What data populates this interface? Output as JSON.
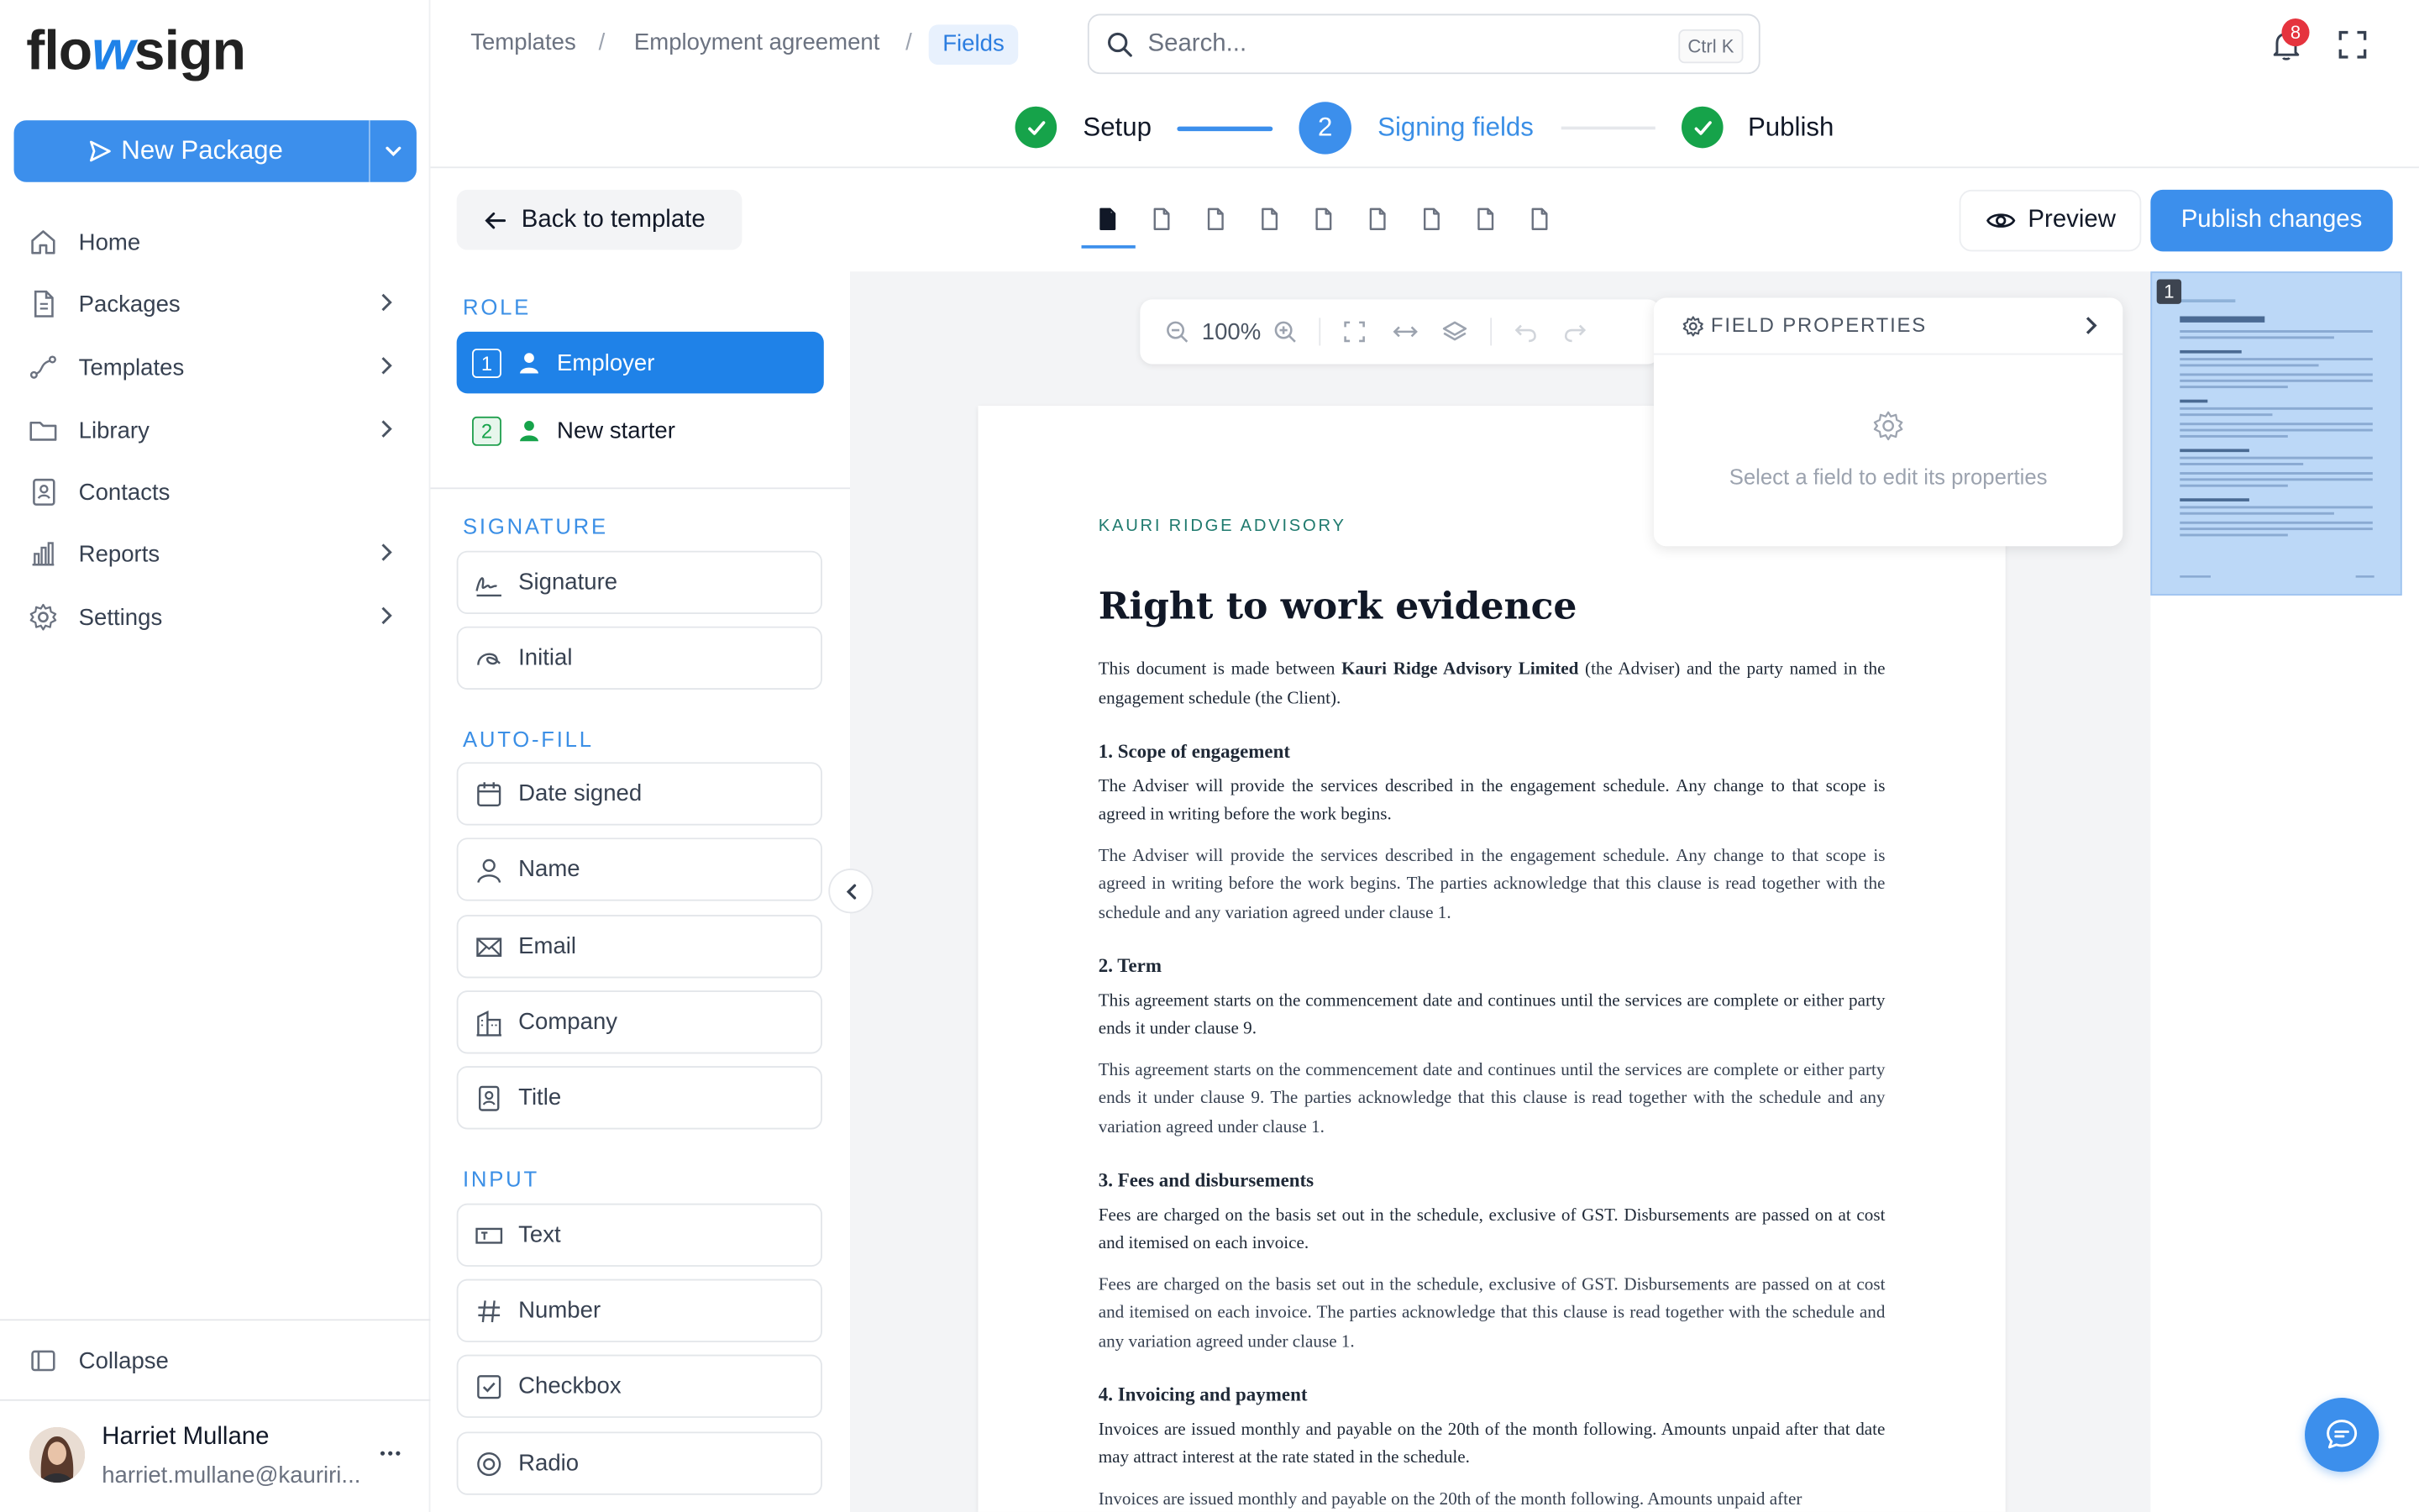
{
  "app": {
    "logo_pre": "flo",
    "logo_mid": "w",
    "logo_post": "sign"
  },
  "sidebar": {
    "new_package": "New Package",
    "items": [
      {
        "label": "Home"
      },
      {
        "label": "Packages"
      },
      {
        "label": "Templates"
      },
      {
        "label": "Library"
      },
      {
        "label": "Contacts"
      },
      {
        "label": "Reports"
      },
      {
        "label": "Settings"
      }
    ],
    "collapse": "Collapse",
    "user": {
      "name": "Harriet Mullane",
      "email": "harriet.mullane@kauriri..."
    }
  },
  "breadcrumb": {
    "items": [
      "Templates",
      "Employment agreement"
    ],
    "active": "Fields"
  },
  "search": {
    "placeholder": "Search...",
    "shortcut": "Ctrl K"
  },
  "notifications": {
    "count": "8"
  },
  "stepper": {
    "steps": [
      {
        "label": "Setup",
        "state": "done"
      },
      {
        "label": "Signing fields",
        "state": "current",
        "number": "2"
      },
      {
        "label": "Publish",
        "state": "done"
      }
    ]
  },
  "panel": {
    "back": "Back to template",
    "role_title": "ROLE",
    "roles": [
      {
        "num": "1",
        "label": "Employer"
      },
      {
        "num": "2",
        "label": "New starter"
      }
    ],
    "signature_title": "SIGNATURE",
    "signature_fields": [
      "Signature",
      "Initial"
    ],
    "autofill_title": "AUTO-FILL",
    "autofill_fields": [
      "Date signed",
      "Name",
      "Email",
      "Company",
      "Title"
    ],
    "input_title": "INPUT",
    "input_fields": [
      "Text",
      "Number",
      "Checkbox",
      "Radio"
    ]
  },
  "toolbar": {
    "zoom": "100%",
    "preview": "Preview",
    "publish": "Publish changes"
  },
  "field_properties": {
    "title": "FIELD PROPERTIES",
    "hint": "Select a field to edit its properties"
  },
  "document": {
    "company": "KAURI RIDGE ADVISORY",
    "title": "Right to work evidence",
    "intro_pre": "This document is made between ",
    "intro_bold": "Kauri Ridge Advisory Limited",
    "intro_post": " (the Adviser) and the party named in the engagement schedule (the Client).",
    "sections": [
      {
        "heading": "1. Scope of engagement",
        "p1": "The Adviser will provide the services described in the engagement schedule. Any change to that scope is agreed in writing before the work begins.",
        "p2": "The Adviser will provide the services described in the engagement schedule. Any change to that scope is agreed in writing before the work begins. The parties acknowledge that this clause is read together with the schedule and any variation agreed under clause 1."
      },
      {
        "heading": "2. Term",
        "p1": "This agreement starts on the commencement date and continues until the services are complete or either party ends it under clause 9.",
        "p2": "This agreement starts on the commencement date and continues until the services are complete or either party ends it under clause 9. The parties acknowledge that this clause is read together with the schedule and any variation agreed under clause 1."
      },
      {
        "heading": "3. Fees and disbursements",
        "p1": "Fees are charged on the basis set out in the schedule, exclusive of GST. Disbursements are passed on at cost and itemised on each invoice.",
        "p2": "Fees are charged on the basis set out in the schedule, exclusive of GST. Disbursements are passed on at cost and itemised on each invoice. The parties acknowledge that this clause is read together with the schedule and any variation agreed under clause 1."
      },
      {
        "heading": "4. Invoicing and payment",
        "p1": "Invoices are issued monthly and payable on the 20th of the month following. Amounts unpaid after that date may attract interest at the rate stated in the schedule.",
        "p2": "Invoices are issued monthly and payable on the 20th of the month following. Amounts unpaid after"
      }
    ]
  },
  "thumbnail": {
    "page": "1"
  },
  "colors": {
    "accent": "#3c8fec",
    "success": "#16a34a",
    "danger": "#e5343e",
    "doc_brand": "#1f7a6e"
  }
}
